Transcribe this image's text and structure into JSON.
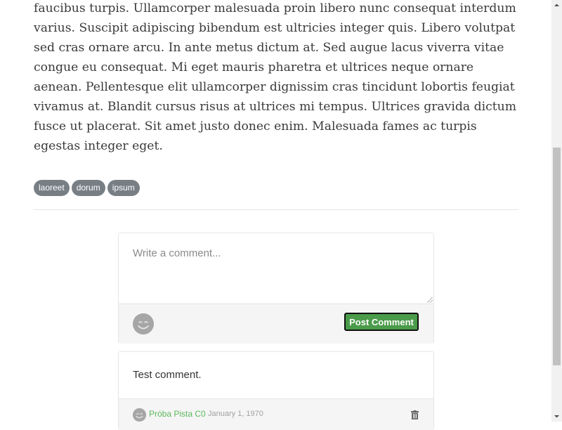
{
  "article": {
    "text": "faucibus turpis. Ullamcorper malesuada proin libero nunc consequat interdum varius. Suscipit adipiscing bibendum est ultricies integer quis. Libero volutpat sed cras ornare arcu. In ante metus dictum at. Sed augue lacus viverra vitae congue eu consequat. Mi eget mauris pharetra et ultrices neque ornare aenean. Pellentesque elit ullamcorper dignissim cras tincidunt lobortis feugiat vivamus at. Blandit cursus risus at ultrices mi tempus. Ultrices gravida dictum fusce ut placerat. Sit amet justo donec enim. Malesuada fames ac turpis egestas integer eget."
  },
  "tags": [
    "laoreet",
    "dorum",
    "ipsum"
  ],
  "comment_form": {
    "placeholder": "Write a comment...",
    "value": "",
    "post_label": "Post Comment"
  },
  "comments": [
    {
      "text": "Test comment.",
      "author": "Próba Pista C0",
      "date": "January 1, 1970"
    }
  ],
  "colors": {
    "accent": "#4a9b4a",
    "author_link": "#5cb85c",
    "tag_bg": "#777f85"
  },
  "icons": {
    "avatar": "smiley-avatar-icon",
    "delete": "trash-icon"
  }
}
